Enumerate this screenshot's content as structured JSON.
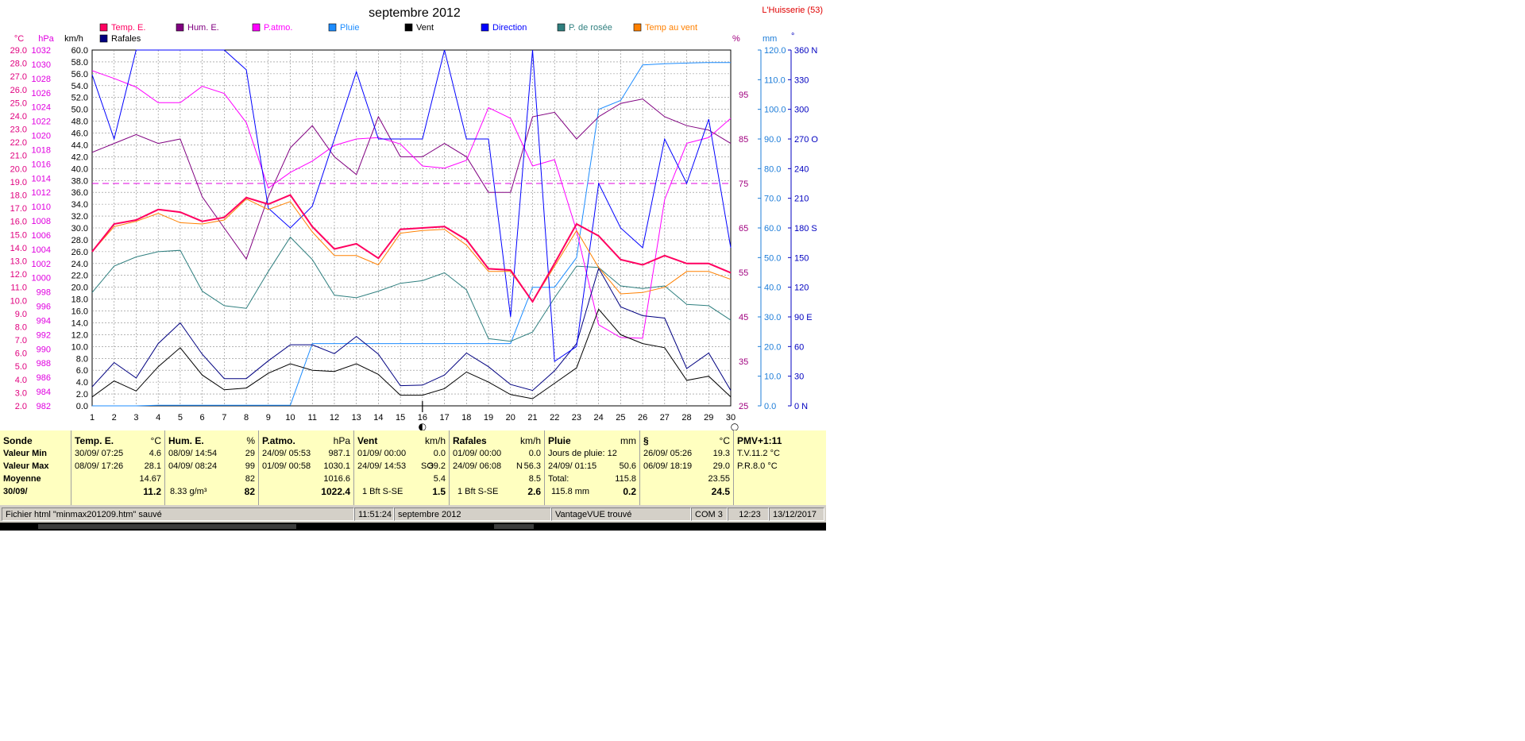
{
  "window": {
    "location": "L'Huisserie (53)"
  },
  "chart_data": {
    "type": "line",
    "title": "septembre 2012",
    "x": [
      1,
      2,
      3,
      4,
      5,
      6,
      7,
      8,
      9,
      10,
      11,
      12,
      13,
      14,
      15,
      16,
      17,
      18,
      19,
      20,
      21,
      22,
      23,
      24,
      25,
      26,
      27,
      28,
      29,
      30
    ],
    "left_axes": [
      {
        "unit": "°C",
        "color": "#e0007f",
        "min": 2.0,
        "max": 29.0,
        "step": 1.0,
        "decimals": 1
      },
      {
        "unit": "hPa",
        "color": "#e000e0",
        "min": 982,
        "max": 1032,
        "step": 2,
        "decimals": 0
      },
      {
        "unit": "km/h",
        "color": "#000000",
        "min": 0.0,
        "max": 60.0,
        "step": 2.0,
        "decimals": 1
      }
    ],
    "right_axes": [
      {
        "unit": "%",
        "color": "#a0007f",
        "min": 25,
        "max": 105,
        "ticks": [
          25,
          35,
          45,
          55,
          65,
          75,
          85,
          95
        ]
      },
      {
        "unit": "mm",
        "color": "#1c7cd8",
        "min": 0.0,
        "max": 120.0,
        "step": 10.0,
        "decimals": 1
      },
      {
        "unit": "°",
        "color": "#0000c0",
        "min": 0,
        "max": 360,
        "tick_labels": [
          "0   N",
          "30",
          "60",
          "90  E",
          "120",
          "150",
          "180 S",
          "210",
          "240",
          "270 O",
          "300",
          "330",
          "360 N"
        ]
      }
    ],
    "legend": [
      {
        "name": "Temp. E.",
        "color": "#ff0060"
      },
      {
        "name": "Hum. E.",
        "color": "#800080"
      },
      {
        "name": "P.atmo.",
        "color": "#ff00ff"
      },
      {
        "name": "Pluie",
        "color": "#1c8cff"
      },
      {
        "name": "Vent",
        "color": "#000000"
      },
      {
        "name": "Direction",
        "color": "#0000ff"
      },
      {
        "name": "P. de rosée",
        "color": "#2f7f7f"
      },
      {
        "name": "Temp au vent",
        "color": "#ff8000"
      },
      {
        "name": "Rafales",
        "color": "#000080"
      }
    ],
    "series": [
      {
        "name": "Temp. E.",
        "axis": "°C",
        "color": "#ff0060",
        "width": 2,
        "values": [
          13.7,
          15.8,
          16.1,
          16.9,
          16.7,
          16.0,
          16.3,
          17.8,
          17.3,
          18.0,
          15.6,
          13.9,
          14.3,
          13.2,
          15.4,
          15.5,
          15.6,
          14.6,
          12.4,
          12.3,
          9.9,
          12.8,
          15.8,
          14.9,
          13.1,
          12.7,
          13.4,
          12.8,
          12.8,
          12.1
        ]
      },
      {
        "name": "Temp au vent",
        "axis": "°C",
        "color": "#ff8000",
        "width": 1,
        "values": [
          13.7,
          15.6,
          16.0,
          16.6,
          15.9,
          15.8,
          16.1,
          17.7,
          16.9,
          17.5,
          15.2,
          13.4,
          13.4,
          12.7,
          15.1,
          15.3,
          15.4,
          14.2,
          12.2,
          12.2,
          9.9,
          12.6,
          15.3,
          12.5,
          10.5,
          10.6,
          11.0,
          12.2,
          12.2,
          11.6
        ]
      },
      {
        "name": "Hum. E.",
        "axis": "%",
        "color": "#800080",
        "width": 1,
        "values": [
          82,
          84,
          86,
          84,
          85,
          72,
          65,
          58,
          72,
          83,
          88,
          81,
          77,
          90,
          81,
          81,
          84,
          81,
          73,
          73,
          90,
          91,
          85,
          90,
          93,
          94,
          90,
          88,
          87,
          84
        ]
      },
      {
        "name": "P.atmo.",
        "axis": "hPa",
        "color": "#ff00ff",
        "width": 1,
        "values": [
          1029.1,
          1028.0,
          1026.8,
          1024.6,
          1024.6,
          1026.9,
          1025.9,
          1021.8,
          1012.6,
          1014.8,
          1016.4,
          1018.6,
          1019.5,
          1019.7,
          1018.8,
          1015.7,
          1015.4,
          1016.5,
          1023.9,
          1022.4,
          1015.7,
          1016.6,
          1006.6,
          993.4,
          991.6,
          991.5,
          1011.0,
          1018.9,
          1019.7,
          1022.4
        ]
      },
      {
        "name": "P. de rosée",
        "axis": "°C",
        "color": "#2f7f7f",
        "width": 1,
        "values": [
          10.6,
          12.6,
          13.3,
          13.7,
          13.8,
          10.7,
          9.6,
          9.4,
          12.2,
          14.8,
          13.1,
          10.4,
          10.2,
          10.7,
          11.3,
          11.5,
          12.1,
          10.8,
          7.1,
          6.9,
          7.6,
          10.2,
          12.6,
          12.5,
          11.1,
          10.9,
          11.1,
          9.7,
          9.6,
          8.5
        ]
      },
      {
        "name": "Pluie",
        "axis": "mm",
        "color": "#1c8cff",
        "width": 1,
        "values": [
          0,
          0,
          0,
          0.2,
          0.2,
          0.2,
          0.2,
          0.2,
          0.2,
          0.2,
          21.0,
          21.0,
          21.0,
          21.0,
          21.0,
          21.0,
          21.0,
          21.0,
          21.0,
          21.0,
          40.0,
          40.0,
          50.0,
          100.0,
          103.0,
          115.0,
          115.4,
          115.6,
          115.8,
          115.8
        ]
      },
      {
        "name": "Vent",
        "axis": "km/h",
        "color": "#000000",
        "width": 1,
        "values": [
          1.5,
          4.2,
          2.5,
          6.6,
          9.8,
          5.2,
          2.7,
          3.0,
          5.5,
          7.1,
          6.0,
          5.8,
          7.1,
          5.3,
          1.8,
          1.8,
          2.9,
          5.7,
          4.0,
          1.9,
          1.2,
          3.8,
          6.4,
          16.3,
          12.0,
          10.5,
          9.8,
          4.3,
          5.0,
          1.5
        ]
      },
      {
        "name": "Rafales",
        "axis": "km/h",
        "color": "#000080",
        "width": 1,
        "values": [
          3.2,
          7.3,
          4.7,
          10.5,
          14.0,
          8.7,
          4.6,
          4.6,
          7.6,
          10.3,
          10.3,
          8.8,
          11.7,
          8.7,
          3.4,
          3.5,
          5.2,
          8.9,
          6.6,
          3.6,
          2.6,
          5.9,
          10.5,
          23.2,
          16.7,
          15.2,
          14.8,
          6.3,
          8.9,
          2.6
        ]
      },
      {
        "name": "Direction",
        "axis": "°",
        "color": "#0000ff",
        "width": 1,
        "values": [
          335,
          270,
          360,
          360,
          360,
          360,
          360,
          340,
          200,
          180,
          202,
          270,
          338,
          270,
          270,
          270,
          360,
          270,
          270,
          90,
          360,
          45,
          60,
          225,
          180,
          160,
          270,
          225,
          290,
          160
        ]
      }
    ],
    "reference_lines": [
      {
        "axis": "hPa",
        "value": 1013.25,
        "color": "#e000e0",
        "style": "dashed"
      }
    ],
    "marker_days": [
      16
    ],
    "moon_markers": [
      {
        "day": 16,
        "symbol": "◐"
      },
      {
        "day": 30,
        "symbol": "○"
      }
    ],
    "ylim_temp": [
      2.0,
      29.0
    ]
  },
  "stats": {
    "row_labels": [
      "Sonde",
      "Valeur Min",
      "Valeur Max",
      "Moyenne",
      "30/09/"
    ],
    "temp": {
      "title": "Temp. E.",
      "unit": "°C",
      "min_time": "30/09/  07:25",
      "min_val": "4.6",
      "max_time": "08/09/  17:26",
      "max_val": "28.1",
      "avg": "14.67",
      "current": "11.2"
    },
    "hum": {
      "title": "Hum. E.",
      "unit": "%",
      "min_time": "08/09/  14:54",
      "min_val": "29",
      "max_time": "04/09/  08:24",
      "max_val": "99",
      "avg": "82",
      "current_extra": "8.33 g/m³",
      "current": "82"
    },
    "patmo": {
      "title": "P.atmo.",
      "unit": "hPa",
      "min_time": "24/09/  05:53",
      "min_val": "987.1",
      "max_time": "01/09/  00:58",
      "max_val": "1030.1",
      "avg": "1016.6",
      "current": "1022.4"
    },
    "vent": {
      "title": "Vent",
      "unit": "km/h",
      "min_time": "01/09/  00:00",
      "min_val": "0.0",
      "max_time": "24/09/  14:53",
      "max_dir": "SO",
      "max_val": "39.2",
      "avg": "5.4",
      "current_extra": "1 Bft S-SE",
      "current": "1.5"
    },
    "rafales": {
      "title": "Rafales",
      "unit": "km/h",
      "min_time": "01/09/  00:00",
      "min_val": "0.0",
      "max_time": "24/09/  06:08",
      "max_dir": "N",
      "max_val": "56.3",
      "avg": "8.5",
      "current_extra": "1 Bft S-SE",
      "current": "2.6"
    },
    "pluie": {
      "title": "Pluie",
      "unit": "mm",
      "row1": "Jours de pluie: 12",
      "max_time": "24/09/  01:15",
      "max_val": "50.6",
      "total_label": "Total:",
      "total_val": "115.8",
      "current_extra": "115.8 mm",
      "current": "0.2"
    },
    "s": {
      "title": "§",
      "unit": "°C",
      "min_time": "26/09/  05:26",
      "min_val": "19.3",
      "max_time": "06/09/  18:19",
      "max_val": "29.0",
      "avg": "23.55",
      "current": "24.5"
    },
    "pmv": {
      "title": "PMV+1:11",
      "tv": "T.V.11.2 °C",
      "pr": "P.R.8.0 °C"
    }
  },
  "statusbar": {
    "file": "Fichier html  \"minmax201209.htm\"  sauvé",
    "time": "11:51:24",
    "month": "septembre 2012",
    "device": "VantageVUE trouvé",
    "port": "COM 3",
    "clock": "12:23",
    "date": "13/12/2017"
  }
}
